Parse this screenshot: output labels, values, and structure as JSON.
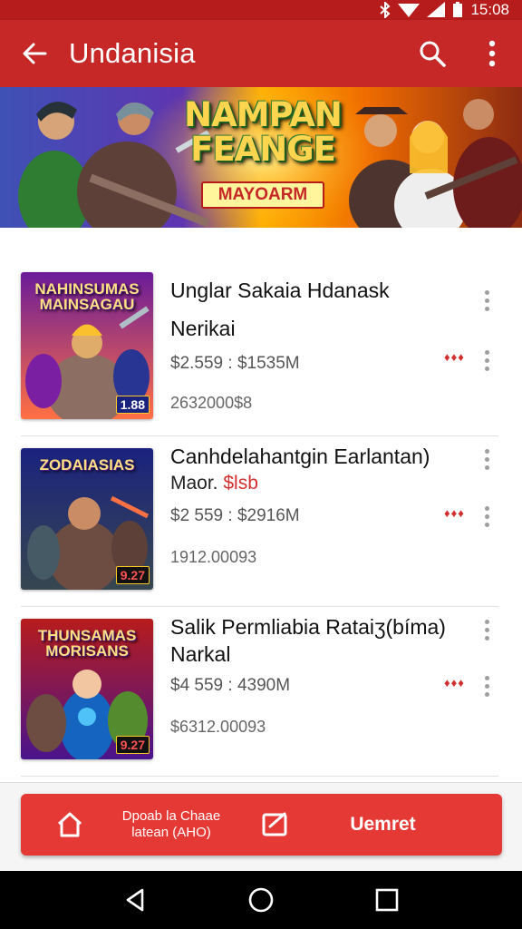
{
  "status_bar": {
    "time": "15:08",
    "icons": [
      "bluetooth-icon",
      "wifi-icon",
      "signal-icon",
      "battery-icon"
    ]
  },
  "app_bar": {
    "title": "Undanisia",
    "icons": [
      "back-arrow-icon",
      "search-icon",
      "more-vert-icon"
    ]
  },
  "banner": {
    "title_line1": "NAMPAN",
    "title_line2": "FEANGE",
    "subtitle": "MAYOARM"
  },
  "items": [
    {
      "thumb_title": "NAHINSUMAS MAINSAGAU",
      "thumb_badge": "1.88",
      "title_line1": "Unglar Sakaia Hdanask",
      "title_line2": "Nerikai",
      "subtitle_prefix": "",
      "subtitle_highlight": "",
      "price": "$2.559 : $1535M",
      "count": "2632000$8",
      "rating": "♦♦♦"
    },
    {
      "thumb_title": "ZODAIASIAS",
      "thumb_badge": "9.27",
      "title_line1": "Canhdelahantgin Earlantan)",
      "title_line2": "",
      "subtitle_prefix": "Maor.",
      "subtitle_highlight": "$lsb",
      "price": "$2 559 : $2916M",
      "count": "1912.00093",
      "rating": "♦♦♦"
    },
    {
      "thumb_title": "THUNSAMAS MORISANS",
      "thumb_badge": "9.27",
      "title_line1": "Salik Permliabia Rataiʒ(bíma)",
      "title_line2": "Narkal",
      "subtitle_prefix": "",
      "subtitle_highlight": "",
      "price": "$4 559 : 4390M",
      "count": "$6312.00093",
      "rating": "♦♦♦"
    }
  ],
  "bottom_bar": {
    "secondary_line1": "Dpoab la Chaae",
    "secondary_line2": "latean (AHO)",
    "primary_label": "Uemret"
  },
  "nav_bar": {
    "icons": [
      "back-triangle-icon",
      "home-circle-icon",
      "recents-square-icon"
    ]
  },
  "colors": {
    "primary": "#c62828",
    "accent": "#e53935",
    "rating": "#d32f2f"
  }
}
